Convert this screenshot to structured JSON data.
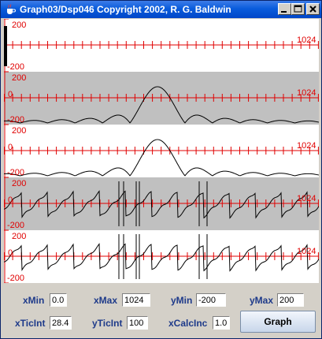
{
  "window": {
    "title": "Graph03/Dsp046 Copyright 2002, R. G. Baldwin",
    "buttons": [
      "minimize",
      "maximize",
      "close"
    ]
  },
  "colors": {
    "axis": "#e00000",
    "trace": "#000000",
    "panel_white": "#ffffff",
    "panel_gray": "#c0c0c0",
    "title_bar": "#0a5cdc"
  },
  "icons": [
    "java-cup-icon",
    "minimize-icon",
    "maximize-icon",
    "close-icon"
  ],
  "panels": [
    {
      "name": "input-impulse",
      "bg": "white",
      "ymax_label": "200",
      "ymin_label": "-200",
      "zero_label": "",
      "xmax_label": "1024"
    },
    {
      "name": "magnitude-spectrum",
      "bg": "gray",
      "ymax_label": "200",
      "ymin_label": "-200",
      "zero_label": "0",
      "xmax_label": "1024"
    },
    {
      "name": "magnitude-spectrum-2",
      "bg": "white",
      "ymax_label": "200",
      "ymin_label": "-200",
      "zero_label": "0",
      "xmax_label": "1024"
    },
    {
      "name": "phase-spectrum",
      "bg": "gray",
      "ymax_label": "200",
      "ymin_label": "-200",
      "zero_label": "0",
      "xmax_label": "1024"
    },
    {
      "name": "phase-spectrum-2",
      "bg": "white",
      "ymax_label": "200",
      "ymin_label": "-200",
      "zero_label": "0",
      "xmax_label": "1024"
    }
  ],
  "controls": {
    "xmin_label": "xMin",
    "xmin_value": "0.0",
    "xmax_label": "xMax",
    "xmax_value": "1024",
    "ymin_label": "yMin",
    "ymin_value": "-200",
    "ymax_label": "yMax",
    "ymax_value": "200",
    "xticint_label": "xTicInt",
    "xticint_value": "28.4",
    "yticint_label": "yTicInt",
    "yticint_value": "100",
    "xcalcinc_label": "xCalcInc",
    "xcalcinc_value": "1.0",
    "graph_button_label": "Graph"
  }
}
